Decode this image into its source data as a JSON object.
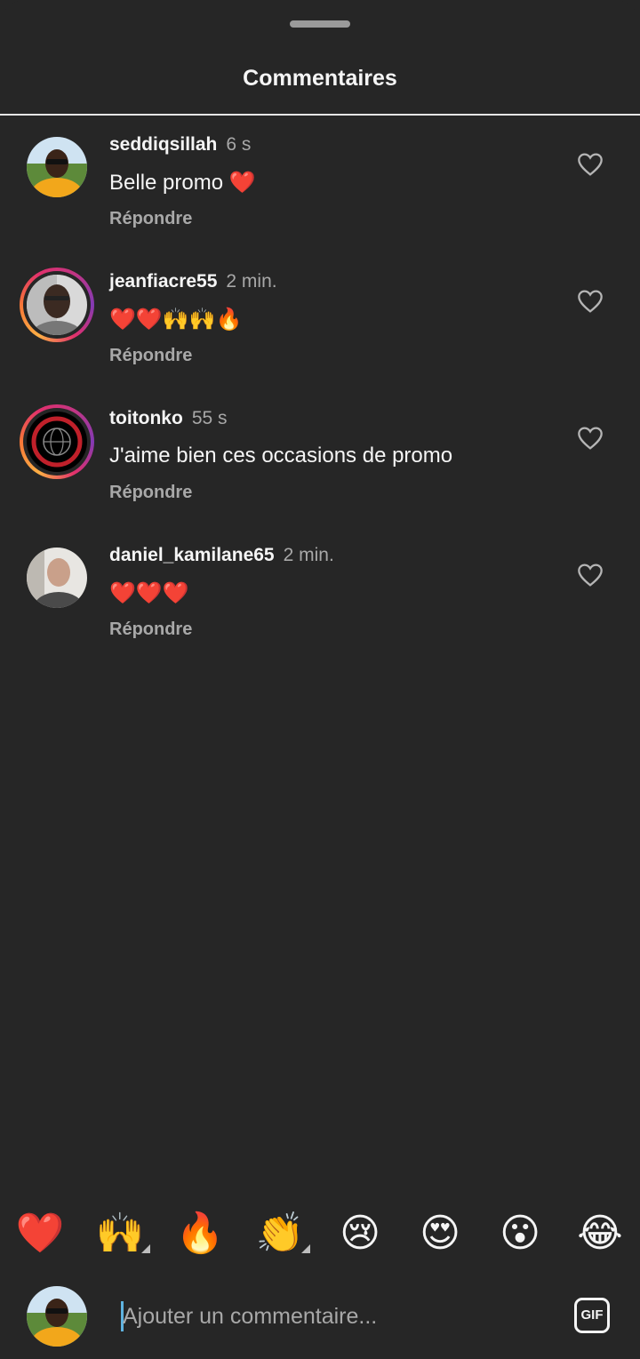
{
  "header": {
    "title": "Commentaires"
  },
  "comments": [
    {
      "username": "seddiqsillah",
      "time": "6 s",
      "text": "Belle promo ❤️",
      "reply": "Répondre"
    },
    {
      "username": "jeanfiacre55",
      "time": "2 min.",
      "text": "❤️❤️🙌🙌🔥",
      "reply": "Répondre"
    },
    {
      "username": "toitonko",
      "time": "55 s",
      "text": "J'aime bien ces occasions de promo",
      "reply": "Répondre"
    },
    {
      "username": "daniel_kamilane65",
      "time": "2 min.",
      "text": "❤️❤️❤️",
      "reply": "Répondre"
    }
  ],
  "quick_reactions": [
    "❤️",
    "🙌",
    "🔥",
    "👏",
    "😢",
    "😍",
    "😮",
    "😂"
  ],
  "composer": {
    "placeholder": "Ajouter un commentaire...",
    "gif_label": "GIF"
  },
  "colors": {
    "background": "#262626",
    "text": "#f5f5f5",
    "secondary": "#a8a8a8",
    "story_ring": [
      "#fcaf45",
      "#e1306c",
      "#833ab4"
    ]
  }
}
